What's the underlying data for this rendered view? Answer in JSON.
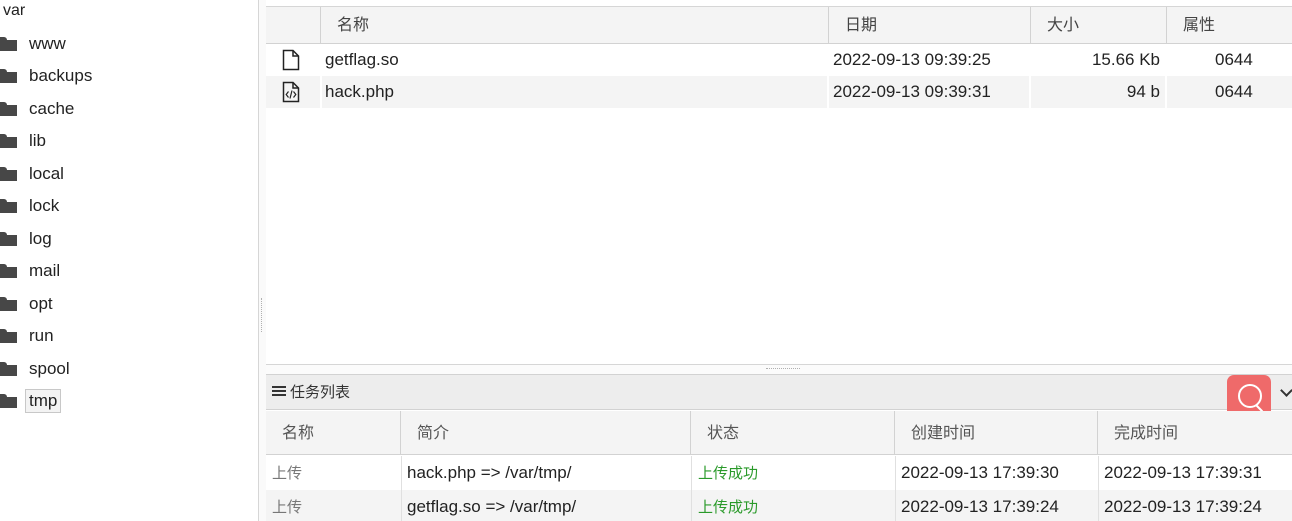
{
  "tree": {
    "root": "var",
    "items": [
      "www",
      "backups",
      "cache",
      "lib",
      "local",
      "lock",
      "log",
      "mail",
      "opt",
      "run",
      "spool",
      "tmp"
    ],
    "selected": "tmp"
  },
  "files": {
    "headers": {
      "name": "名称",
      "date": "日期",
      "size": "大小",
      "attr": "属性"
    },
    "rows": [
      {
        "icon": "file-icon",
        "name": "getflag.so",
        "date": "2022-09-13 09:39:25",
        "size": "15.66 Kb",
        "attr": "0644"
      },
      {
        "icon": "php-file-icon",
        "name": "hack.php",
        "date": "2022-09-13 09:39:31",
        "size": "94 b",
        "attr": "0644"
      }
    ]
  },
  "tasks": {
    "title": "任务列表",
    "headers": {
      "name": "名称",
      "desc": "简介",
      "status": "状态",
      "created": "创建时间",
      "finished": "完成时间"
    },
    "rows": [
      {
        "name": "上传",
        "desc": "hack.php => /var/tmp/",
        "status": "上传成功",
        "created": "2022-09-13 17:39:30",
        "finished": "2022-09-13 17:39:31"
      },
      {
        "name": "上传",
        "desc": "getflag.so => /var/tmp/",
        "status": "上传成功",
        "created": "2022-09-13 17:39:24",
        "finished": "2022-09-13 17:39:24"
      }
    ]
  },
  "colors": {
    "accent": "#ef6a6a",
    "success": "#2a9a2a",
    "folder": "#474747"
  },
  "icons": {
    "search": "search-icon",
    "collapse": "chevron-down-icon",
    "task_list": "list-icon",
    "folder": "folder-icon"
  }
}
